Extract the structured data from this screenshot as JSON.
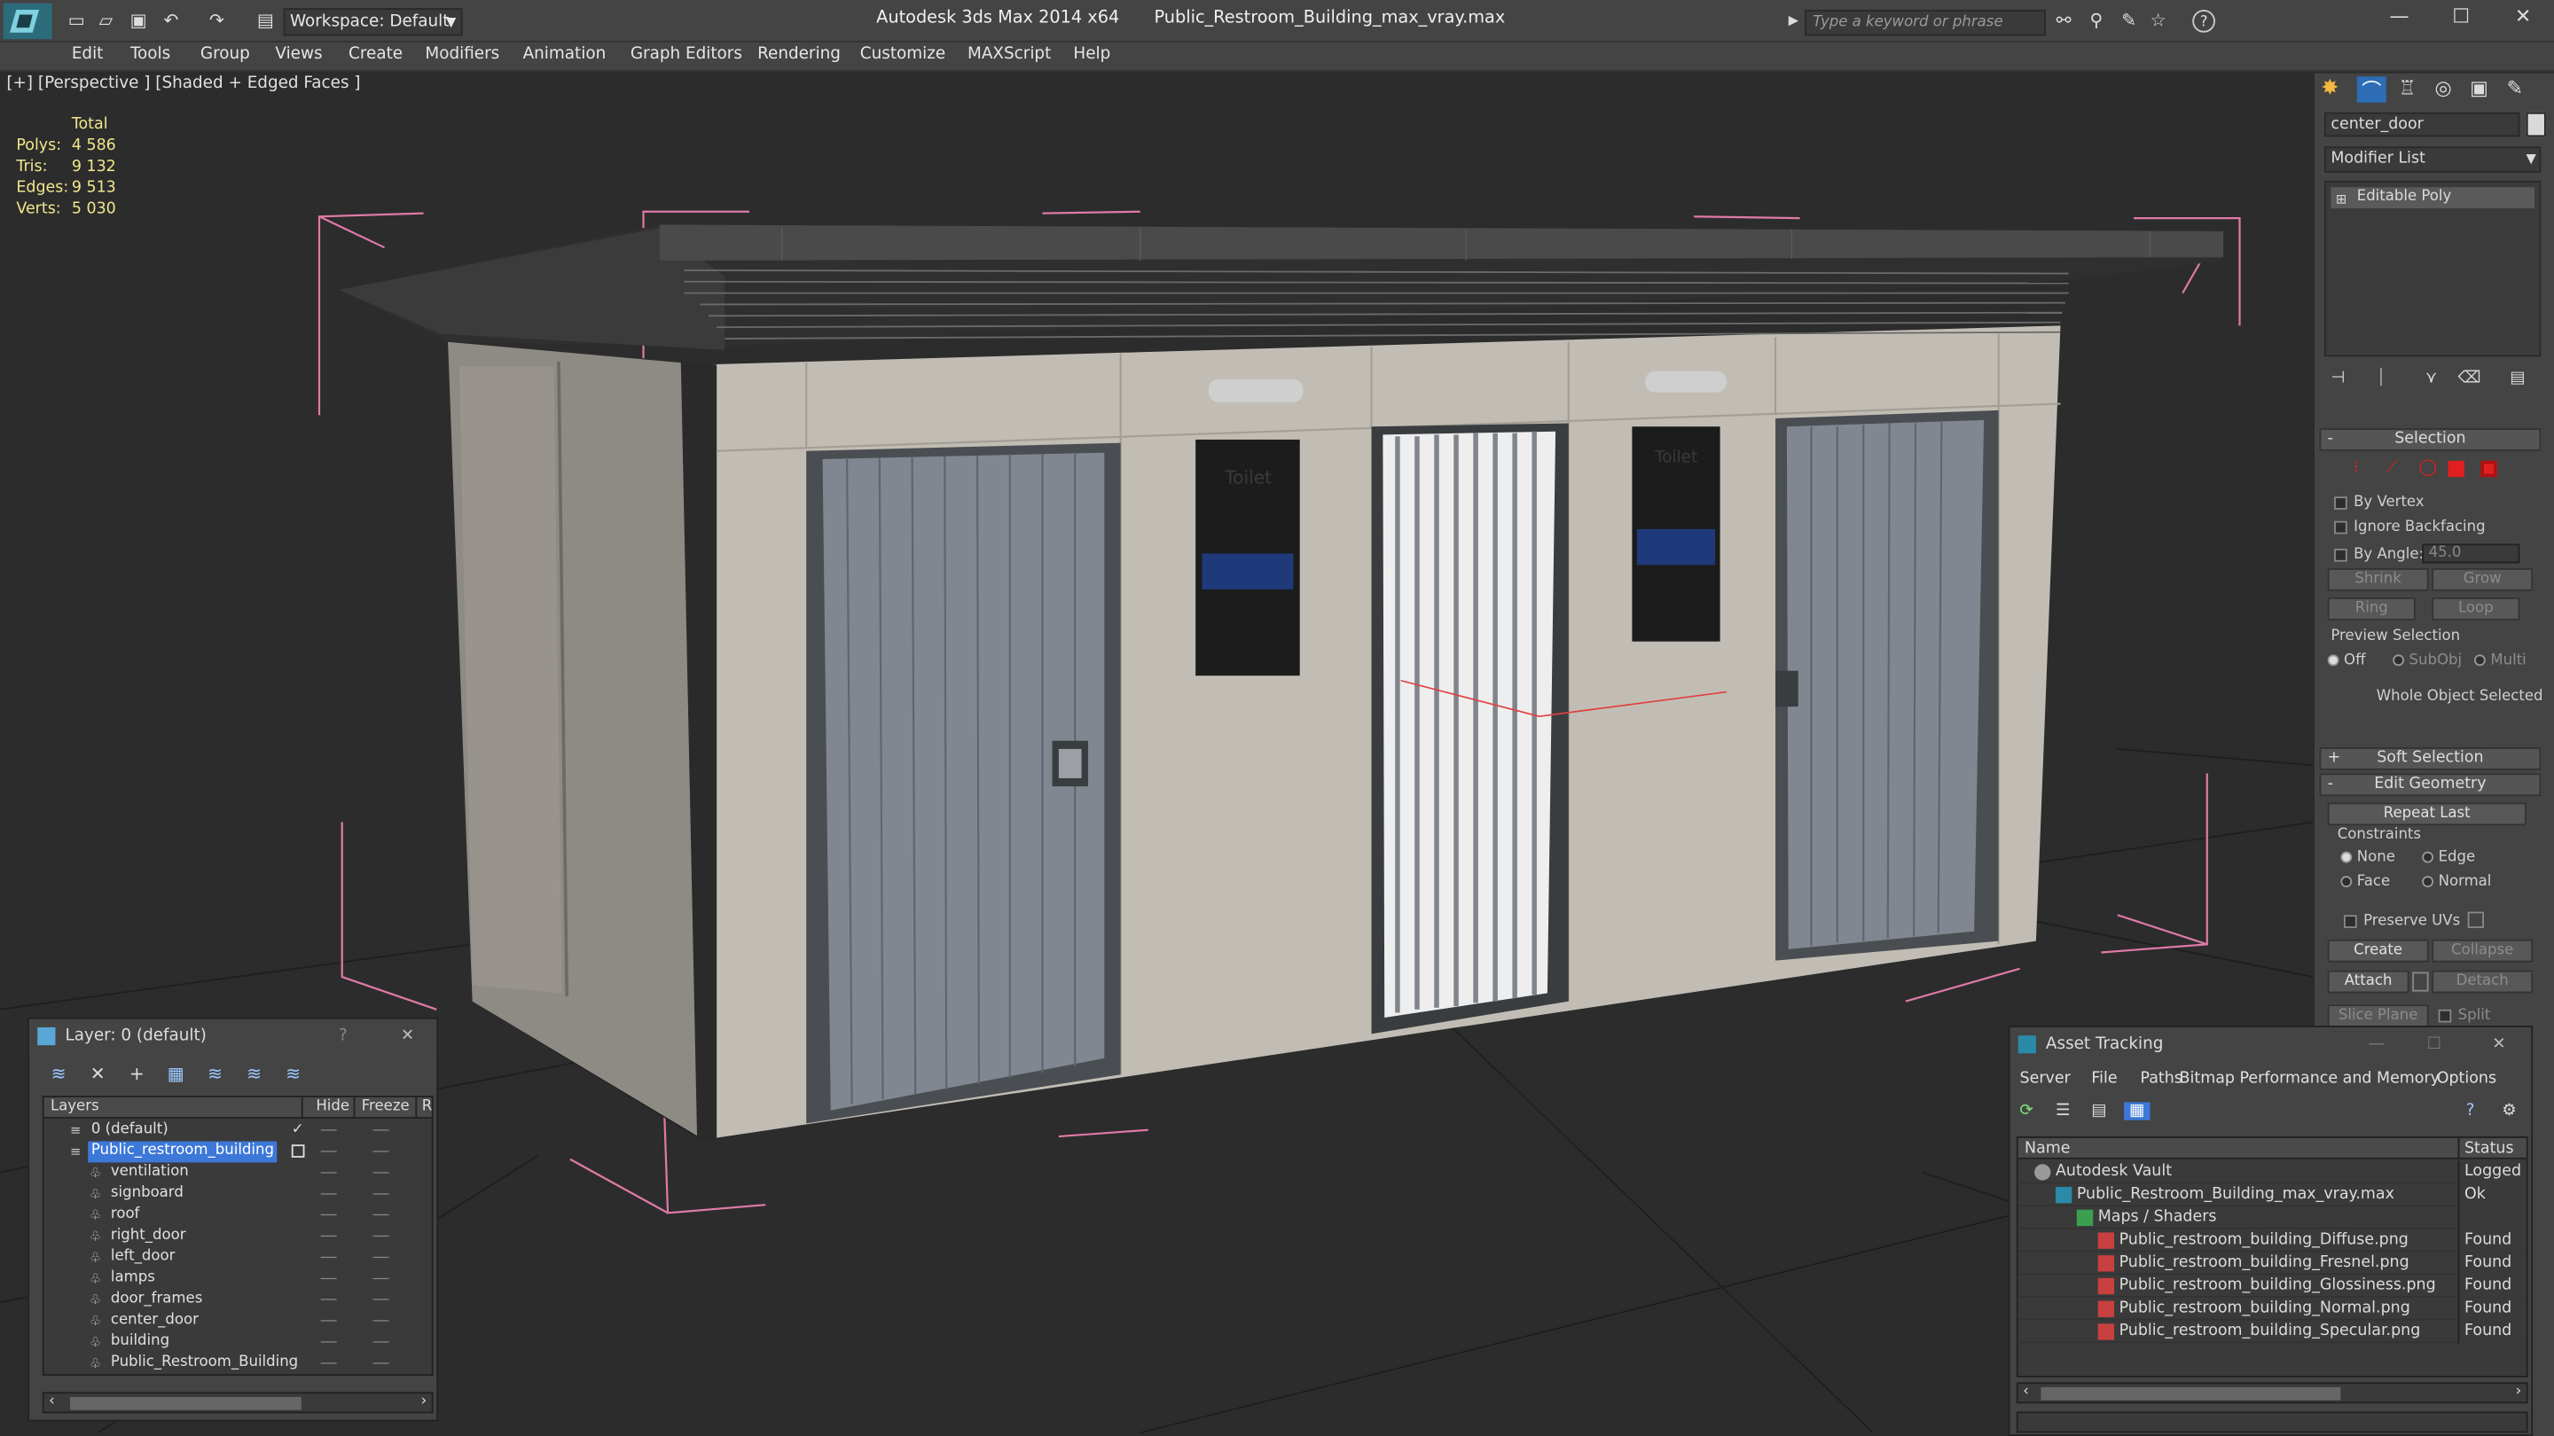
{
  "window": {
    "app_title": "Autodesk 3ds Max  2014 x64",
    "file_title": "Public_Restroom_Building_max_vray.max",
    "workspace": "Workspace: Default",
    "search_placeholder": "Type a keyword or phrase"
  },
  "menu": [
    "Edit",
    "Tools",
    "Group",
    "Views",
    "Create",
    "Modifiers",
    "Animation",
    "Graph Editors",
    "Rendering",
    "Customize",
    "MAXScript",
    "Help"
  ],
  "viewport": {
    "label": "[+] [Perspective ] [Shaded + Edged Faces ]",
    "stats": {
      "header": "Total",
      "polys_label": "Polys:",
      "polys": "4 586",
      "tris_label": "Tris:",
      "tris": "9 132",
      "edges_label": "Edges:",
      "edges": "9 513",
      "verts_label": "Verts:",
      "verts": "5 030"
    },
    "signs": {
      "left": "Toilet",
      "right": "Toilet"
    }
  },
  "command_panel": {
    "object_name": "center_door",
    "modifier_list": "Modifier List",
    "stack_entry": "Editable Poly",
    "selection": {
      "title": "Selection",
      "by_vertex": "By Vertex",
      "ignore_backfacing": "Ignore Backfacing",
      "by_angle": "By Angle:",
      "angle_value": "45.0",
      "shrink": "Shrink",
      "grow": "Grow",
      "ring": "Ring",
      "loop": "Loop",
      "preview_selection": "Preview Selection",
      "preview_off": "Off",
      "preview_subobj": "SubObj",
      "preview_multi": "Multi",
      "status": "Whole Object Selected"
    },
    "soft_selection": "Soft Selection",
    "edit_geometry": {
      "title": "Edit Geometry",
      "repeat_last": "Repeat Last",
      "constraints": "Constraints",
      "none": "None",
      "edge": "Edge",
      "face": "Face",
      "normal": "Normal",
      "preserve_uvs": "Preserve UVs",
      "create": "Create",
      "collapse": "Collapse",
      "attach": "Attach",
      "detach": "Detach",
      "slice_plane": "Slice Plane",
      "split": "Split"
    },
    "colors": {
      "red_vertex": "#e02020",
      "accent": "#3c78d8"
    }
  },
  "layer_dialog": {
    "title": "Layer: 0 (default)",
    "help": "?",
    "columns": {
      "layers": "Layers",
      "hide": "Hide",
      "freeze": "Freeze",
      "render": "R"
    },
    "rows": [
      {
        "name": "0 (default)",
        "level": 0
      },
      {
        "name": "Public_restroom_building",
        "level": 0,
        "selected": true
      },
      {
        "name": "ventilation",
        "level": 1
      },
      {
        "name": "signboard",
        "level": 1
      },
      {
        "name": "roof",
        "level": 1
      },
      {
        "name": "right_door",
        "level": 1
      },
      {
        "name": "left_door",
        "level": 1
      },
      {
        "name": "lamps",
        "level": 1
      },
      {
        "name": "door_frames",
        "level": 1
      },
      {
        "name": "center_door",
        "level": 1
      },
      {
        "name": "building",
        "level": 1
      },
      {
        "name": "Public_Restroom_Building",
        "level": 1
      }
    ]
  },
  "asset_tracking": {
    "title": "Asset Tracking",
    "menu": [
      "Server",
      "File",
      "Paths",
      "Bitmap Performance and Memory",
      "Options"
    ],
    "columns": {
      "name": "Name",
      "status": "Status"
    },
    "rows": [
      {
        "name": "Autodesk Vault",
        "status": "Logged O",
        "level": 0,
        "icon": "vault-icon"
      },
      {
        "name": "Public_Restroom_Building_max_vray.max",
        "status": "Ok",
        "level": 1,
        "icon": "max-file-icon"
      },
      {
        "name": "Maps / Shaders",
        "status": "",
        "level": 2,
        "icon": "maps-icon"
      },
      {
        "name": "Public_restroom_building_Diffuse.png",
        "status": "Found",
        "level": 3,
        "icon": "png-icon"
      },
      {
        "name": "Public_restroom_building_Fresnel.png",
        "status": "Found",
        "level": 3,
        "icon": "png-icon"
      },
      {
        "name": "Public_restroom_building_Glossiness.png",
        "status": "Found",
        "level": 3,
        "icon": "png-icon"
      },
      {
        "name": "Public_restroom_building_Normal.png",
        "status": "Found",
        "level": 3,
        "icon": "png-icon"
      },
      {
        "name": "Public_restroom_building_Specular.png",
        "status": "Found",
        "level": 3,
        "icon": "png-icon"
      }
    ]
  }
}
